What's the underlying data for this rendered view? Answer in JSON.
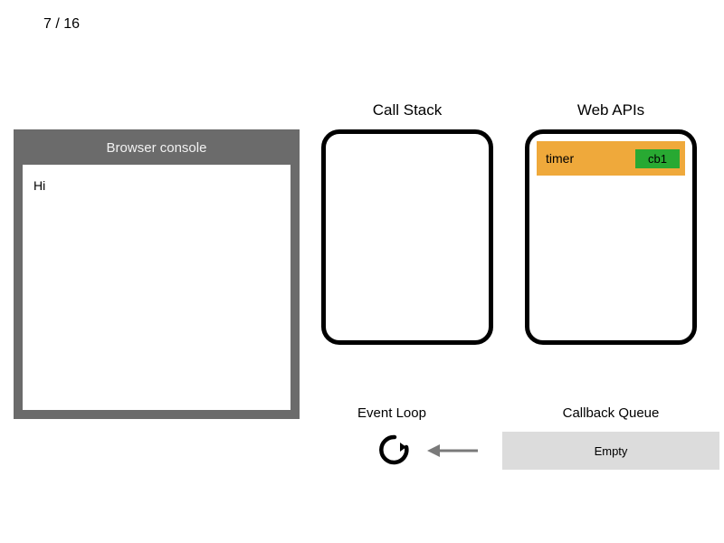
{
  "step": {
    "current": 7,
    "total": 16,
    "display": "7 / 16"
  },
  "console": {
    "title": "Browser console",
    "lines": [
      "Hi"
    ]
  },
  "sections": {
    "call_stack": {
      "label": "Call Stack",
      "items": []
    },
    "web_apis": {
      "label": "Web APIs",
      "items": [
        {
          "name": "timer",
          "callback": "cb1"
        }
      ]
    },
    "event_loop": {
      "label": "Event Loop"
    },
    "callback_queue": {
      "label": "Callback Queue",
      "status": "Empty"
    }
  }
}
